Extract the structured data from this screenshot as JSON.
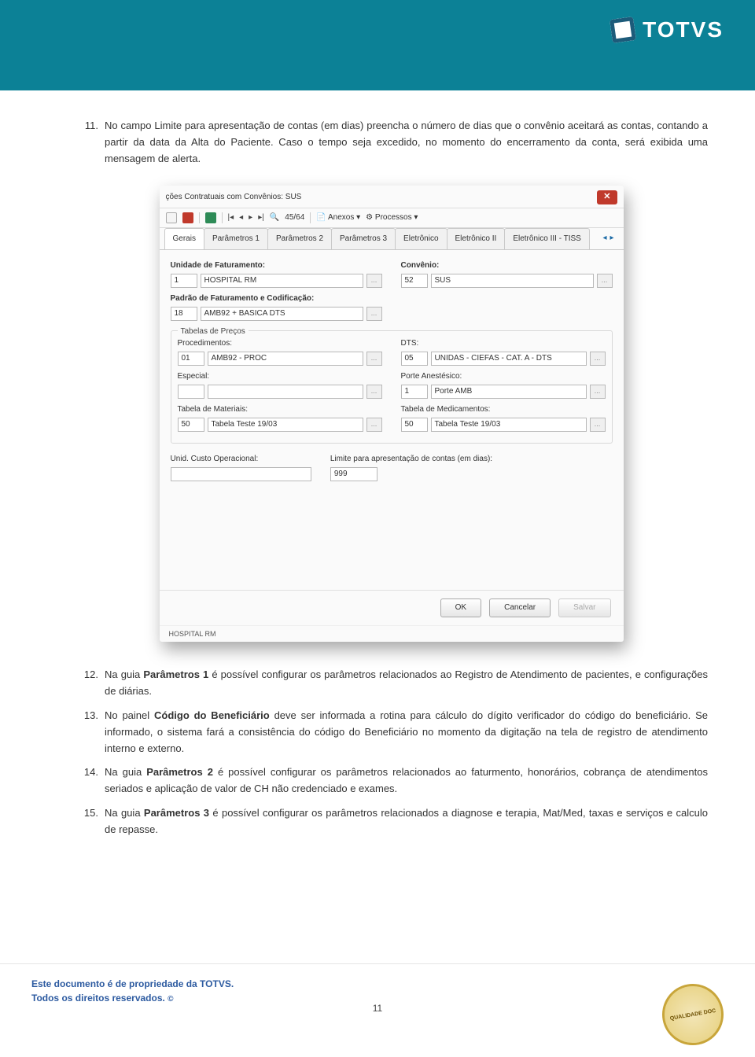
{
  "brand": "TOTVS",
  "items": [
    {
      "num": "11.",
      "a": "No campo Limite para apresentação de contas (em dias) preencha o número de dias que o convênio aceitará as contas, contando a partir da data da Alta do Paciente. Caso o tempo seja excedido, no momento do encerramento da conta, será exibida uma mensagem de alerta."
    },
    {
      "num": "12.",
      "a": "Na guia",
      "b": "Parâmetros 1",
      "c": "é possível configurar os parâmetros relacionados ao Registro de Atendimento de pacientes, e configurações de diárias."
    },
    {
      "num": "13.",
      "a": "No painel",
      "b": "Código do Beneficiário",
      "c": "deve ser informada a rotina para cálculo do dígito verificador do código do beneficiário. Se informado, o sistema fará a consistência do código do Beneficiário no momento da digitação na tela de registro de atendimento interno e externo."
    },
    {
      "num": "14.",
      "a": "Na guia",
      "b": "Parâmetros 2",
      "c": "é possível configurar os parâmetros relacionados ao faturmento, honorários, cobrança de atendimentos seriados e aplicação de valor de CH não credenciado e exames."
    },
    {
      "num": "15.",
      "a": "Na guia",
      "b": "Parâmetros 3",
      "c": "é possível configurar os parâmetros relacionados a diagnose e terapia, Mat/Med, taxas e serviços e calculo de repasse."
    }
  ],
  "win": {
    "title": "ções Contratuais com Convênios: SUS",
    "counter": "45/64",
    "anexos": "Anexos",
    "proc": "Processos",
    "tabs": [
      "Gerais",
      "Parâmetros 1",
      "Parâmetros 2",
      "Parâmetros 3",
      "Eletrônico",
      "Eletrônico II",
      "Eletrônico III - TISS"
    ],
    "f": {
      "unidade_lbl": "Unidade de Faturamento:",
      "unidade_code": "1",
      "unidade_name": "HOSPITAL RM",
      "padrao_lbl": "Padrão de Faturamento e Codificação:",
      "padrao_code": "18",
      "padrao_name": "AMB92 + BASICA DTS",
      "conv_lbl": "Convênio:",
      "conv_code": "52",
      "conv_name": "SUS",
      "tab_precos": "Tabelas de Preços",
      "proc_lbl": "Procedimentos:",
      "proc_code": "01",
      "proc_name": "AMB92 - PROC",
      "esp_lbl": "Especial:",
      "mat_lbl": "Tabela de Materiais:",
      "mat_code": "50",
      "mat_name": "Tabela Teste 19/03",
      "dts_lbl": "DTS:",
      "dts_code": "05",
      "dts_name": "UNIDAS - CIEFAS - CAT. A - DTS",
      "porte_lbl": "Porte Anestésico:",
      "porte_code": "1",
      "porte_name": "Porte AMB",
      "med_lbl": "Tabela de Medicamentos:",
      "med_code": "50",
      "med_name": "Tabela Teste 19/03",
      "custo_lbl": "Unid. Custo Operacional:",
      "limite_lbl": "Limite para apresentação de contas (em dias):",
      "limite_val": "999"
    },
    "btns": [
      "OK",
      "Cancelar",
      "Salvar"
    ],
    "frag": "HOSPITAL RM"
  },
  "pagenum": "11",
  "footer": {
    "l1": "Este documento é de propriedade da TOTVS.",
    "l2": "Todos os direitos reservados.",
    "seal": "QUALIDADE DOC"
  }
}
